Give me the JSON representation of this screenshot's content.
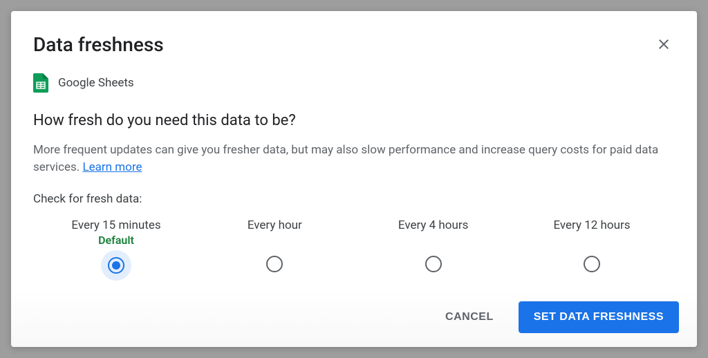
{
  "dialog": {
    "title": "Data freshness",
    "source_name": "Google Sheets",
    "question": "How fresh do you need this data to be?",
    "description": "More frequent updates can give you fresher data, but may also slow performance and increase query costs for paid data services. ",
    "learn_more": "Learn more",
    "check_label": "Check for fresh data:",
    "default_tag": "Default",
    "options": [
      {
        "label": "Every 15 minutes",
        "is_default": true,
        "selected": true
      },
      {
        "label": "Every hour",
        "is_default": false,
        "selected": false
      },
      {
        "label": "Every 4 hours",
        "is_default": false,
        "selected": false
      },
      {
        "label": "Every 12 hours",
        "is_default": false,
        "selected": false
      }
    ],
    "cancel_label": "CANCEL",
    "submit_label": "SET DATA FRESHNESS"
  }
}
